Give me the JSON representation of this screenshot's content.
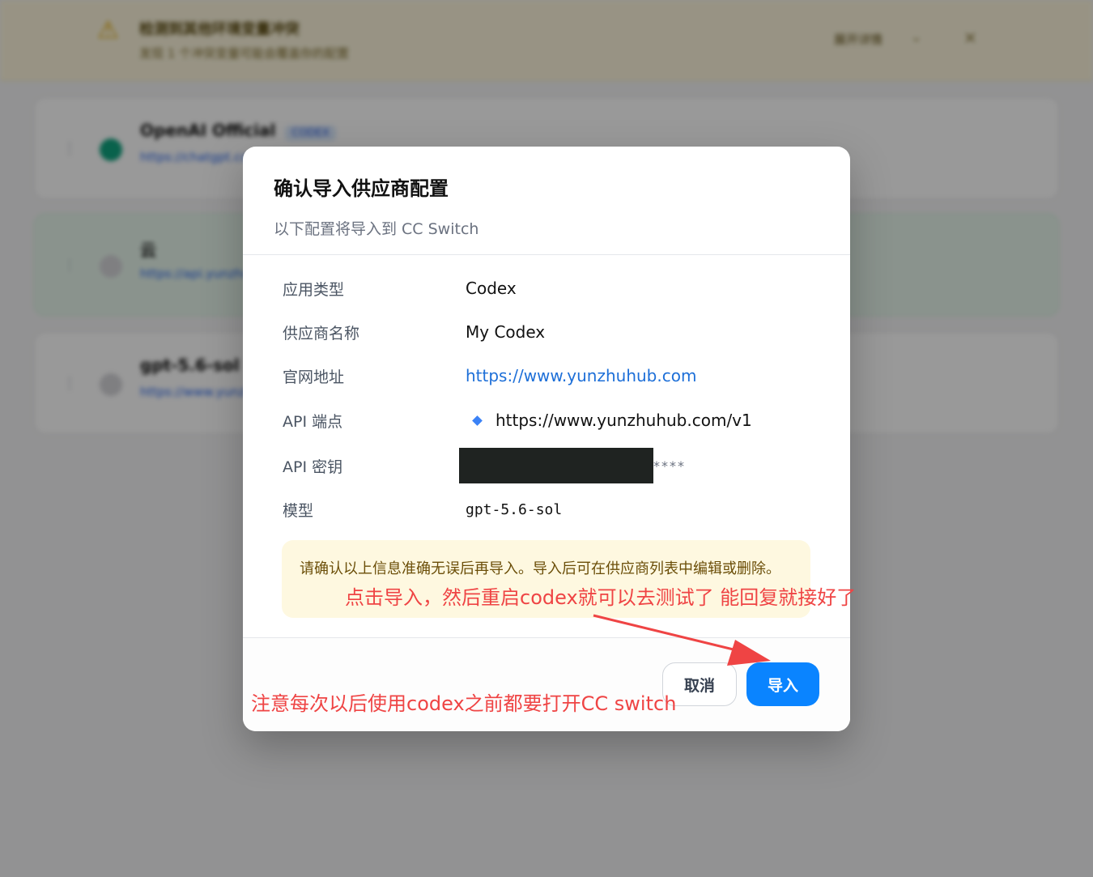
{
  "background": {
    "banner": {
      "title": "检测到其他环境变量冲突",
      "subtitle": "发现 1 个冲突变量可能会覆盖你的配置",
      "action_label": "展开详情"
    },
    "providers": [
      {
        "name": "OpenAI Official",
        "tag": "CODEX",
        "url": "https://chatgpt.com"
      },
      {
        "name": "云",
        "url": "https://api.yunzhuhub.com"
      },
      {
        "name": "gpt-5.6-sol",
        "url": "https://www.yunzhuhub.com"
      }
    ]
  },
  "dialog": {
    "title": "确认导入供应商配置",
    "subtitle": "以下配置将导入到 CC Switch",
    "fields": [
      {
        "label": "应用类型",
        "value": "Codex"
      },
      {
        "label": "供应商名称",
        "value": "My Codex"
      },
      {
        "label": "官网地址",
        "value": "https://www.yunzhuhub.com"
      },
      {
        "label": "API 端点",
        "value": "https://www.yunzhuhub.com/v1"
      },
      {
        "label": "API 密钥",
        "value": "****"
      },
      {
        "label": "模型",
        "value": "gpt-5.6-sol"
      }
    ],
    "note": "请确认以上信息准确无误后再导入。导入后可在供应商列表中编辑或删除。",
    "cancel_label": "取消",
    "import_label": "导入"
  },
  "annotations": {
    "note1": "点击导入，然后重启codex就可以去测试了 能回复就接好了",
    "note2": "注意每次以后使用codex之前都要打开CC switch"
  },
  "colors": {
    "primary_button": "#0a84ff",
    "annotation": "#ef4444",
    "link": "#1d6fd8",
    "note_bg": "#fef8e0"
  }
}
